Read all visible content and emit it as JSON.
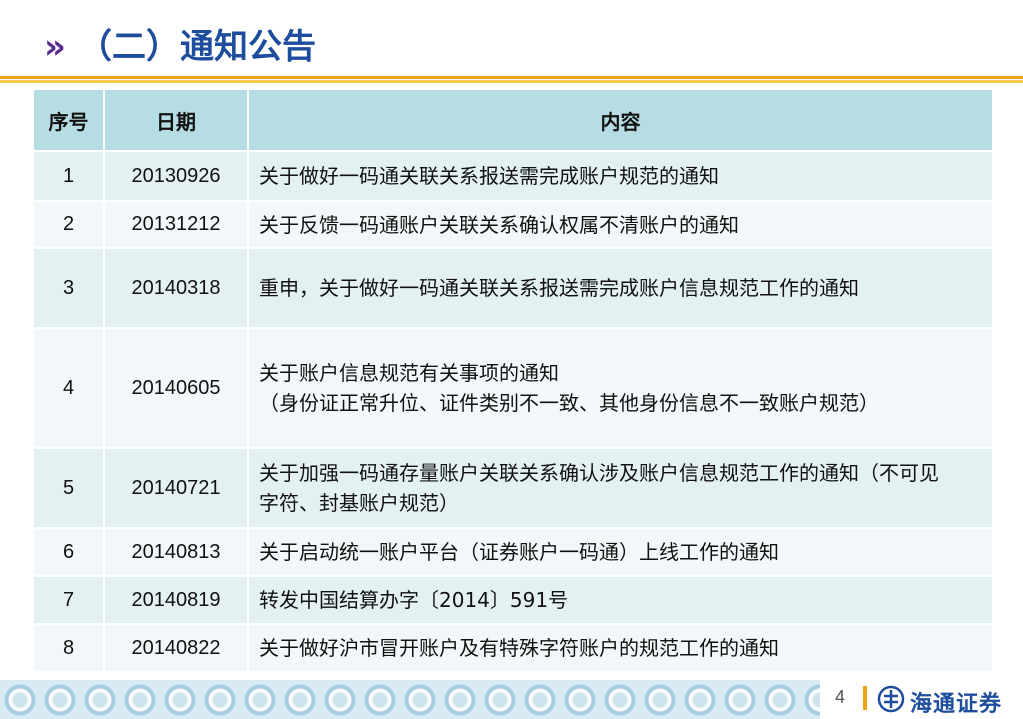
{
  "header": {
    "chevrons": "»",
    "title": "（二）通知公告"
  },
  "table": {
    "columns": [
      "序号",
      "日期",
      "内容"
    ],
    "rows": [
      {
        "seq": "1",
        "date": "20130926",
        "content": [
          "关于做好一码通关联关系报送需完成账户规范的通知"
        ]
      },
      {
        "seq": "2",
        "date": "20131212",
        "content": [
          "关于反馈一码通账户关联关系确认权属不清账户的通知"
        ]
      },
      {
        "seq": "3",
        "date": "20140318",
        "content": [
          "重申，关于做好一码通关联关系报送需完成账户信息规范工作的通知"
        ]
      },
      {
        "seq": "4",
        "date": "20140605",
        "content": [
          "关于账户信息规范有关事项的通知",
          "（身份证正常升位、证件类别不一致、其他身份信息不一致账户规范）"
        ]
      },
      {
        "seq": "5",
        "date": "20140721",
        "content": [
          "关于加强一码通存量账户关联关系确认涉及账户信息规范工作的通知（不可见",
          "字符、封基账户规范）"
        ]
      },
      {
        "seq": "6",
        "date": "20140813",
        "content": [
          "关于启动统一账户平台（证券账户一码通）上线工作的通知"
        ]
      },
      {
        "seq": "7",
        "date": "20140819",
        "content": [
          "转发中国结算办字〔2014〕591号"
        ]
      },
      {
        "seq": "8",
        "date": "20140822",
        "content": [
          "关于做好沪市冒开账户及有特殊字符账户的规范工作的通知"
        ]
      }
    ]
  },
  "footer": {
    "page_number": "4",
    "logo_text": "海通证券",
    "logo_icon": "haitong-logo-icon"
  },
  "colors": {
    "title": "#1d4d9c",
    "chevron": "#5b2a8c",
    "rule_orange": "#f0a31a",
    "header_cell": "#b6dde3",
    "row_odd": "#e4f1f3",
    "row_even": "#f2f8f9"
  }
}
